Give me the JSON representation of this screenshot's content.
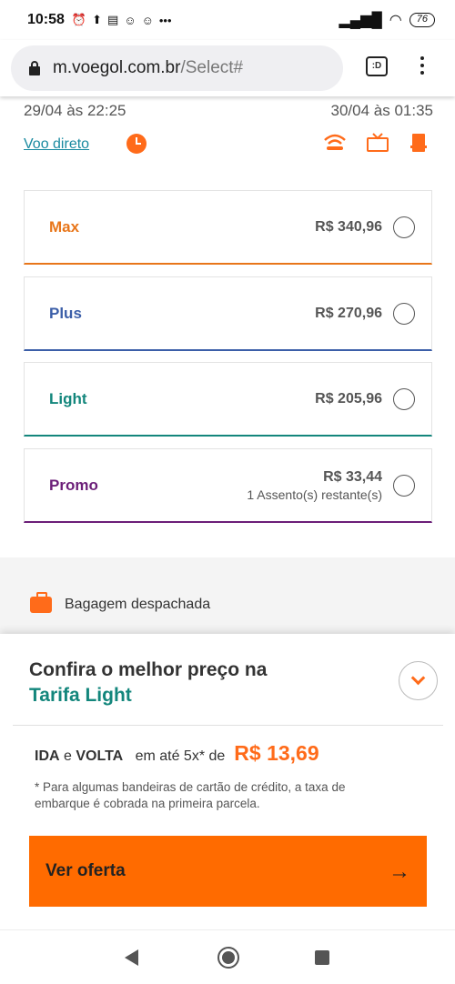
{
  "status_bar": {
    "time": "10:58",
    "battery": "76"
  },
  "browser": {
    "domain": "m.voegol.com.br",
    "path": "/Select#",
    "tab_label": ":D"
  },
  "flight": {
    "departure": "29/04 às 22:25",
    "arrival": "30/04 às 01:35",
    "direct_link": "Voo direto"
  },
  "fares": [
    {
      "name": "Max",
      "price": "R$ 340,96",
      "color": "#e8761a",
      "note": ""
    },
    {
      "name": "Plus",
      "price": "R$ 270,96",
      "color": "#3b5ea8",
      "note": ""
    },
    {
      "name": "Light",
      "price": "R$ 205,96",
      "color": "#13867c",
      "note": ""
    },
    {
      "name": "Promo",
      "price": "R$ 33,44",
      "color": "#6b1e78",
      "note": "1 Assento(s) restante(s)"
    }
  ],
  "baggage": {
    "label": "Bagagem despachada"
  },
  "offer_sheet": {
    "title": "Confira o melhor preço na",
    "title_highlight": "Tarifa Light",
    "ida": "IDA",
    "e": "e",
    "volta": "VOLTA",
    "installment_text": "em até 5x* de",
    "installment_price": "R$ 13,69",
    "note": "* Para algumas bandeiras de cartão de crédito, a taxa de embarque é cobrada na primeira parcela.",
    "cta_label": "Ver oferta",
    "cta_arrow": "→"
  },
  "colors": {
    "accent": "#ff6b00",
    "light_fare": "#13867c"
  }
}
